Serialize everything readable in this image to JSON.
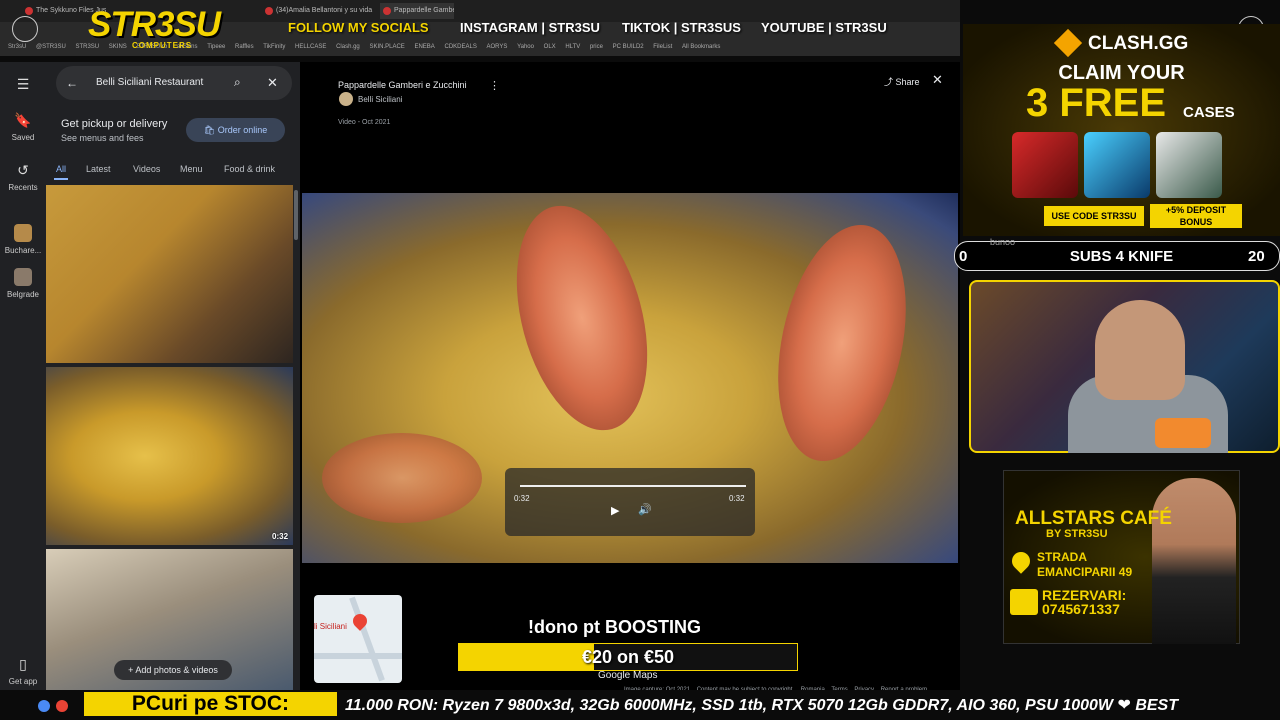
{
  "browser": {
    "tabs": [
      "The Sykkuno Files Just D...",
      "(34)Amalia Bellantoni y su vida",
      "Pappardelle Gamberi e Zuc"
    ],
    "bookmarks": [
      "Str3sU",
      "@STR3SU",
      "STR3SU",
      "SKINS",
      "STR3SU.ro",
      "allSkins",
      "Tipeee",
      "Raffles",
      "TikFinity",
      "HELLCASE",
      "Clash.gg",
      "SKIN.PLACE",
      "ENEBA",
      "CDKDEALS",
      "AORYS",
      "Yahoo",
      "OLX",
      "HLTV",
      "price",
      "PC BUILD2",
      "FileList",
      "All Bookmarks"
    ]
  },
  "overlay": {
    "logo_main": "STR3SU",
    "logo_sub": "COMPUTERS",
    "follow_label": "FOLLOW MY SOCIALS",
    "instagram": "INSTAGRAM  |  STR3SU",
    "tiktok": "TIKTOK  |  STR3SUS",
    "youtube": "YOUTUBE  |  STR3SU"
  },
  "maps": {
    "rail": {
      "saved": "Saved",
      "recents": "Recents",
      "place1": "Buchare...",
      "place2": "Belgrade",
      "get_app": "Get app"
    },
    "search_value": "Belli Siciliani Restaurant",
    "pickup_title": "Get pickup or delivery",
    "pickup_sub": "See menus and fees",
    "order_label": "Order online",
    "tabs": [
      "All",
      "Latest",
      "Videos",
      "Menu",
      "Food & drink"
    ],
    "photo_duration": "0:32",
    "add_photos": "Add photos & videos"
  },
  "viewer": {
    "title": "Pappardelle Gamberi e Zucchini",
    "user": "Belli Siciliani",
    "date": "Video - Oct 2021",
    "share": "Share",
    "time_current": "0:32",
    "time_total": "0:32",
    "progress": 1.0,
    "map_label": "li Siciliani",
    "google_maps": "Google Maps",
    "footer": [
      "Image capture: Oct 2021",
      "Content may be subject to copyright.",
      "Romania",
      "Terms",
      "Privacy",
      "Report a problem"
    ]
  },
  "donation": {
    "title": "!dono pt BOOSTING",
    "progress_text": "€20 on €50",
    "current": 20,
    "goal": 50
  },
  "ad": {
    "brand": "CLASH.GG",
    "claim": "CLAIM YOUR",
    "free": "3 FREE",
    "cases": "CASES",
    "use_code": "USE CODE STR3SU",
    "deposit": "+5% DEPOSIT BONUS"
  },
  "subs": {
    "left": "0",
    "center": "SUBS 4 KNIFE",
    "right": "20",
    "brand": "bunoo"
  },
  "cafe": {
    "title": "ALLSTARS CAFÉ",
    "by": "BY STR3SU",
    "street1": "STRADA",
    "street2": "EMANCIPARII 49",
    "rez_label": "REZERVARI:",
    "phone": "0745671337"
  },
  "ticker": {
    "label": "PCuri pe STOC:",
    "text": "11.000 RON: Ryzen 7 9800x3d, 32Gb 6000MHz, SSD 1tb, RTX 5070 12Gb GDDR7, AIO 360, PSU 1000W  ❤ BEST"
  },
  "colors": {
    "accent": "#f4d400",
    "maps_bg": "#202124",
    "link": "#8ab4f8"
  }
}
